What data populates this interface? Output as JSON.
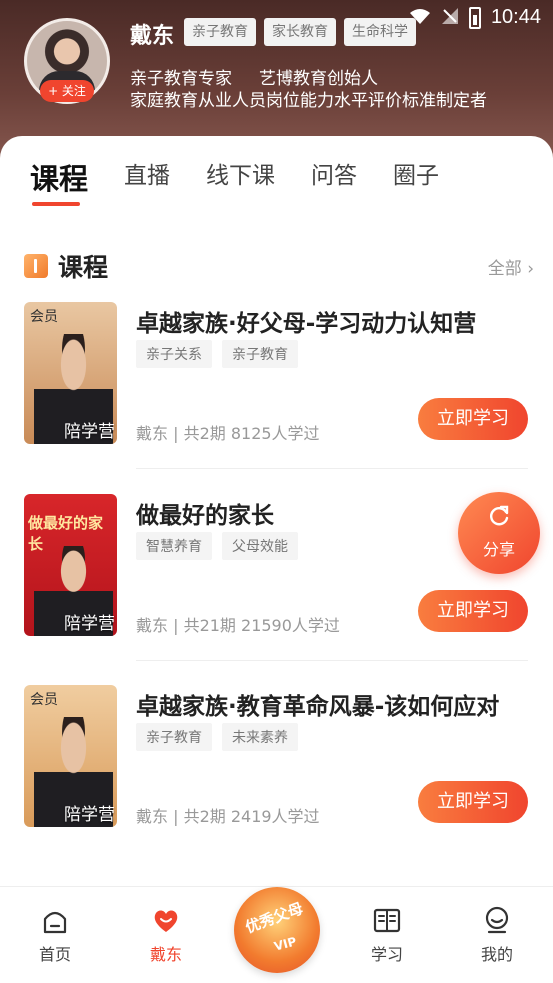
{
  "status_bar": {
    "time": "10:44"
  },
  "profile": {
    "name": "戴东",
    "follow_label": "+ 关注",
    "tags": [
      "亲子教育",
      "家长教育",
      "生命科学"
    ],
    "intro_line1": "亲子教育专家     艺博教育创始人",
    "intro_line2": "家庭教育从业人员岗位能力水平评价标准制定者"
  },
  "tabs": [
    "课程",
    "直播",
    "线下课",
    "问答",
    "圈子"
  ],
  "section": {
    "title": "课程",
    "all_label": "全部"
  },
  "courses": [
    {
      "title": "卓越家族·好父母-学习动力认知营",
      "tags": [
        "亲子关系",
        "亲子教育"
      ],
      "meta": "戴东 | 共2期   8125人学过",
      "button": "立即学习",
      "cover_badge": "会员",
      "cover_camp": "陪学营"
    },
    {
      "title": "做最好的家长",
      "tags": [
        "智慧养育",
        "父母效能"
      ],
      "meta": "戴东 | 共21期   21590人学过",
      "button": "立即学习",
      "cover_title": "做最好的家长",
      "cover_camp": "陪学营"
    },
    {
      "title": "卓越家族·教育革命风暴-该如何应对",
      "tags": [
        "亲子教育",
        "未来素养"
      ],
      "meta": "戴东 | 共2期   2419人学过",
      "button": "立即学习",
      "cover_badge": "会员",
      "cover_camp": "陪学营"
    }
  ],
  "share": {
    "label": "分享"
  },
  "bottom_nav": {
    "items": [
      "首页",
      "戴东",
      "学习",
      "我的"
    ],
    "center_text": "优秀父母",
    "center_vip": "VIP"
  },
  "colors": {
    "accent": "#f0452e",
    "header_bg": "#5a3430"
  }
}
